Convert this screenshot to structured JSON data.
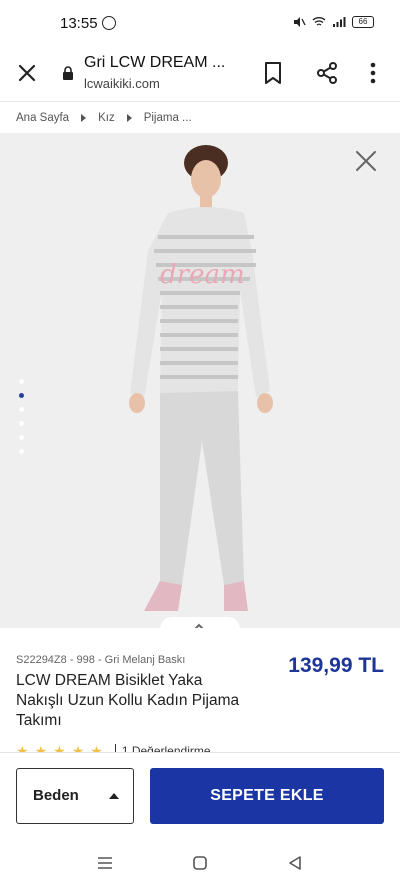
{
  "status_bar": {
    "time": "13:55",
    "battery": "66",
    "icons": [
      "whatsapp-icon",
      "mute-icon",
      "wifi-icon",
      "signal-icon",
      "battery-icon"
    ]
  },
  "browser": {
    "title": "Gri LCW DREAM ...",
    "url": "lcwaikiki.com",
    "icons": [
      "close-icon",
      "lock-icon",
      "bookmark-icon",
      "share-icon",
      "more-vert-icon"
    ]
  },
  "breadcrumb": [
    "Ana Sayfa",
    "Kız",
    "Pijama ..."
  ],
  "gallery": {
    "image_count": 6,
    "active_index": 1,
    "graphic_text": "dream",
    "icons": [
      "close-icon",
      "chevron-up-icon"
    ]
  },
  "product": {
    "sku": "S22294Z8 - 998 - Gri Melanj Baskı",
    "name": "LCW DREAM Bisiklet Yaka Nakışlı Uzun Kollu Kadın Pijama Takımı",
    "price": "139,99 TL",
    "rating_stars": 5,
    "rating_text": "1 Değerlendirme"
  },
  "actions": {
    "size_label": "Beden",
    "add_to_cart": "SEPETE EKLE"
  },
  "colors": {
    "brand_blue": "#1b36a4",
    "price_blue": "#1d3597",
    "star_yellow": "#f2c04a",
    "image_bg": "#efefef"
  },
  "nav_bar": {
    "icons": [
      "recents-icon",
      "home-icon",
      "back-icon"
    ]
  }
}
